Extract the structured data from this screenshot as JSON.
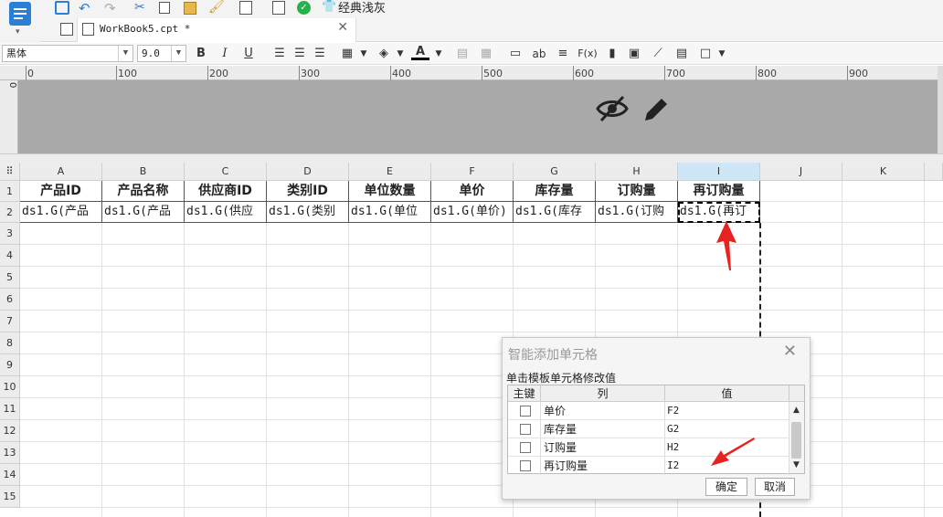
{
  "toolbar": {
    "theme_label": "经典浅灰"
  },
  "tab": {
    "title": "WorkBook5.cpt *"
  },
  "format_bar": {
    "font_family": "黑体",
    "font_size": "9.0",
    "bold": "B",
    "italic": "I",
    "underline": "U",
    "text_sample": "ab",
    "formula": "F(x)"
  },
  "ruler": {
    "ticks": [
      "0",
      "100",
      "200",
      "300",
      "400",
      "500",
      "600",
      "700",
      "800",
      "900"
    ],
    "vertical_zero": "0"
  },
  "grid": {
    "columns": [
      "A",
      "B",
      "C",
      "D",
      "E",
      "F",
      "G",
      "H",
      "I",
      "J",
      "K"
    ],
    "rows": [
      "1",
      "2",
      "3",
      "4",
      "5",
      "6",
      "7",
      "8",
      "9",
      "10",
      "11",
      "12",
      "13",
      "14",
      "15"
    ],
    "header_row": [
      "产品ID",
      "产品名称",
      "供应商ID",
      "类别ID",
      "单位数量",
      "单价",
      "库存量",
      "订购量",
      "再订购量"
    ],
    "data_row": [
      "ds1.G(产品",
      "ds1.G(产品",
      "ds1.G(供应",
      "ds1.G(类别",
      "ds1.G(单位",
      "ds1.G(单价)",
      "ds1.G(库存",
      "ds1.G(订购",
      "ds1.G(再订"
    ]
  },
  "dialog": {
    "title": "智能添加单元格",
    "hint": "单击模板单元格修改值",
    "col_key": "主键",
    "col_column": "列",
    "col_value": "值",
    "rows": [
      {
        "column": "单价",
        "value": "F2"
      },
      {
        "column": "库存量",
        "value": "G2"
      },
      {
        "column": "订购量",
        "value": "H2"
      },
      {
        "column": "再订购量",
        "value": "I2"
      }
    ],
    "ok_label": "确定",
    "cancel_label": "取消"
  },
  "colors": {
    "accent_blue": "#2a7fd4",
    "annotation_red": "#e8231f",
    "header_band": "#a9a9a9",
    "selected_column": "#cfe6f7"
  }
}
